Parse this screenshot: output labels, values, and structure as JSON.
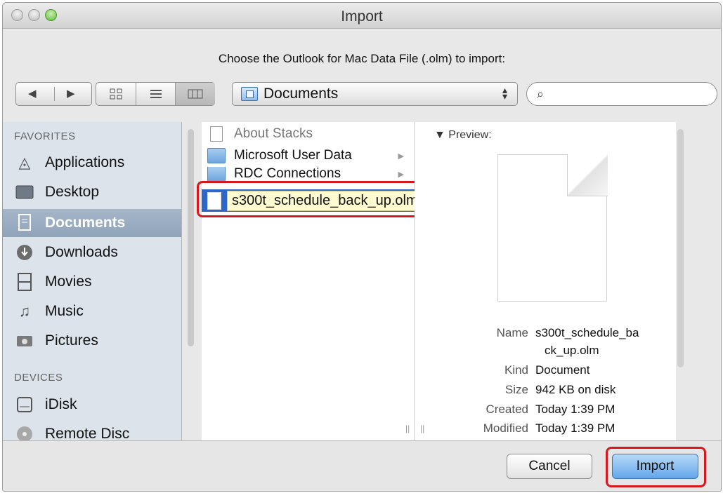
{
  "window": {
    "title": "Import"
  },
  "prompt": "Choose the Outlook for Mac Data File (.olm) to import:",
  "toolbar": {
    "back_icon": "◀",
    "forward_icon": "▶",
    "view_icons": [
      "icon-view-icon",
      "list-view-icon",
      "column-view-icon"
    ],
    "location": "Documents",
    "search_placeholder": ""
  },
  "sidebar": {
    "favorites_header": "FAVORITES",
    "devices_header": "DEVICES",
    "items": [
      {
        "label": "Applications",
        "icon": "applications-icon"
      },
      {
        "label": "Desktop",
        "icon": "desktop-icon"
      },
      {
        "label": "Documents",
        "icon": "documents-icon",
        "selected": true
      },
      {
        "label": "Downloads",
        "icon": "downloads-icon"
      },
      {
        "label": "Movies",
        "icon": "movies-icon"
      },
      {
        "label": "Music",
        "icon": "music-icon"
      },
      {
        "label": "Pictures",
        "icon": "pictures-icon"
      }
    ],
    "devices": [
      {
        "label": "iDisk",
        "icon": "idisk-icon"
      },
      {
        "label": "Remote Disc",
        "icon": "remote-disc-icon"
      }
    ]
  },
  "files": [
    {
      "name": "About Stacks",
      "kind": "document",
      "dim": true
    },
    {
      "name": "Microsoft User Data",
      "kind": "folder"
    },
    {
      "name": "RDC Connections",
      "kind": "folder"
    }
  ],
  "selected_file": "s300t_schedule_back_up.olm",
  "preview": {
    "header": "Preview:",
    "rows": [
      {
        "key": "Name",
        "value": "s300t_schedule_ba"
      },
      {
        "key": "",
        "value": "ck_up.olm"
      },
      {
        "key": "Kind",
        "value": "Document"
      },
      {
        "key": "Size",
        "value": "942 KB on disk"
      },
      {
        "key": "Created",
        "value": "Today 1:39 PM"
      },
      {
        "key": "Modified",
        "value": "Today 1:39 PM"
      }
    ]
  },
  "buttons": {
    "cancel": "Cancel",
    "import": "Import"
  }
}
